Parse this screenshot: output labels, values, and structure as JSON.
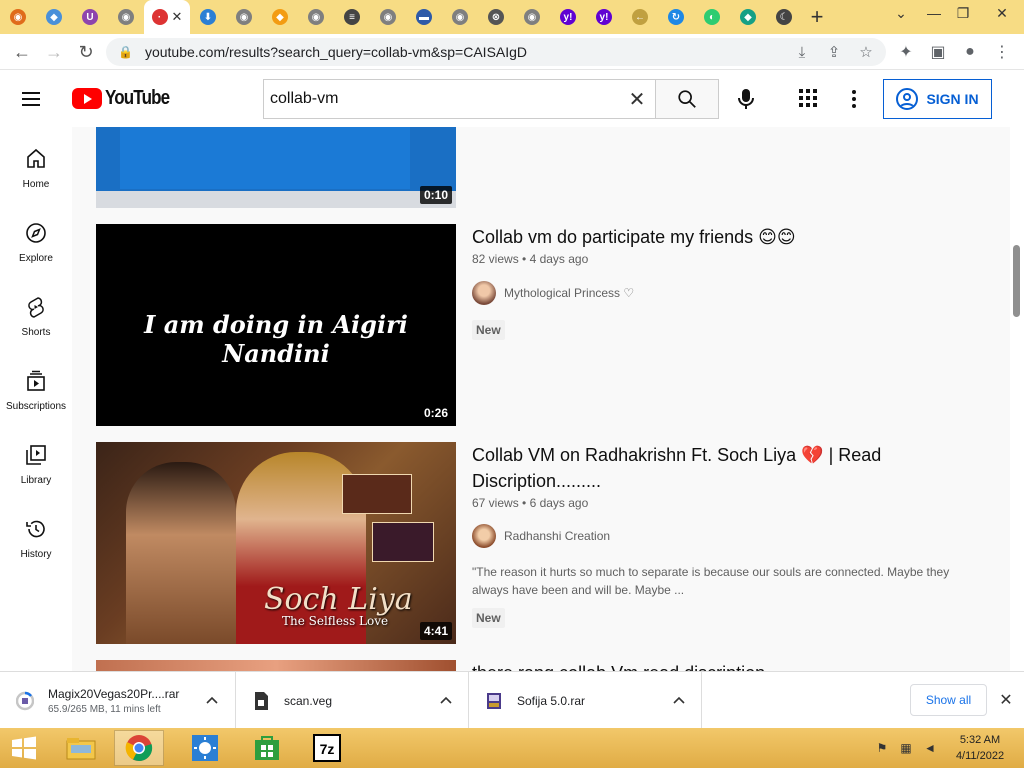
{
  "browser": {
    "url": "youtube.com/results?search_query=collab-vm&sp=CAISAIgD",
    "tabs": [
      {
        "color": "#e06c1b",
        "glyph": "◉"
      },
      {
        "color": "#4a90d9",
        "glyph": "◆"
      },
      {
        "color": "#8e44ad",
        "glyph": "U"
      },
      {
        "color": "#7f7f7f",
        "glyph": "◉"
      },
      {
        "color": "#d33",
        "glyph": "·",
        "active": true
      },
      {
        "color": "#2b7fd4",
        "glyph": "⬇"
      },
      {
        "color": "#7f7f7f",
        "glyph": "◉"
      },
      {
        "color": "#f39c12",
        "glyph": "◆"
      },
      {
        "color": "#7f7f7f",
        "glyph": "◉"
      },
      {
        "color": "#444",
        "glyph": "≡"
      },
      {
        "color": "#7f7f7f",
        "glyph": "◉"
      },
      {
        "color": "#2e5aa8",
        "glyph": "▬"
      },
      {
        "color": "#7f7f7f",
        "glyph": "◉"
      },
      {
        "color": "#555",
        "glyph": "⊗"
      },
      {
        "color": "#7f7f7f",
        "glyph": "◉"
      },
      {
        "color": "#6001d2",
        "glyph": "y!"
      },
      {
        "color": "#6001d2",
        "glyph": "y!"
      },
      {
        "color": "#c0a040",
        "glyph": "←"
      },
      {
        "color": "#1e88e5",
        "glyph": "↻"
      },
      {
        "color": "#2ecc71",
        "glyph": "◐"
      },
      {
        "color": "#16a085",
        "glyph": "◆"
      },
      {
        "color": "#444",
        "glyph": "☾"
      }
    ]
  },
  "youtube": {
    "logo_text": "YouTube",
    "search_value": "collab-vm",
    "sign_in_label": "SIGN IN",
    "guide": [
      {
        "label": "Home",
        "icon": "home-icon"
      },
      {
        "label": "Explore",
        "icon": "compass-icon"
      },
      {
        "label": "Shorts",
        "icon": "shorts-icon"
      },
      {
        "label": "Subscriptions",
        "icon": "subscriptions-icon"
      },
      {
        "label": "Library",
        "icon": "library-icon"
      },
      {
        "label": "History",
        "icon": "history-icon"
      }
    ],
    "results": [
      {
        "title": "",
        "duration": "0:10"
      },
      {
        "title": "Collab vm do participate my friends 😊😊",
        "views": "82 views",
        "age": "4 days ago",
        "channel": "Mythological Princess ♡",
        "badge": "New",
        "thumb_text": "I am doing in Aigiri Nandini",
        "duration": "0:26"
      },
      {
        "title": "Collab VM on Radhakrishn Ft. Soch Liya 💔 | Read Discription.........",
        "views": "67 views",
        "age": "6 days ago",
        "channel": "Radhanshi Creation",
        "description": "\"The reason it hurts so much to separate is because our souls are connected. Maybe they always have been and will be. Maybe ...",
        "badge": "New",
        "thumb_text_1": "Soch Liya",
        "thumb_text_2": "The Selfless Love",
        "duration": "4:41"
      },
      {
        "title": "there rang collab Vm read discription"
      }
    ]
  },
  "downloads": [
    {
      "name": "Magix20Vegas20Pr....rar",
      "status": "65.9/265 MB, 11 mins left"
    },
    {
      "name": "scan.veg",
      "status": ""
    },
    {
      "name": "Sofija 5.0.rar",
      "status": ""
    }
  ],
  "shelf": {
    "show_all_label": "Show all"
  },
  "taskbar": {
    "time": "5:32 AM",
    "date": "4/11/2022"
  },
  "colors": {
    "youtube_red": "#ff0000",
    "link_blue": "#065fd4",
    "taskbar": "#f2c86a",
    "tabstrip": "#f7dc84"
  }
}
